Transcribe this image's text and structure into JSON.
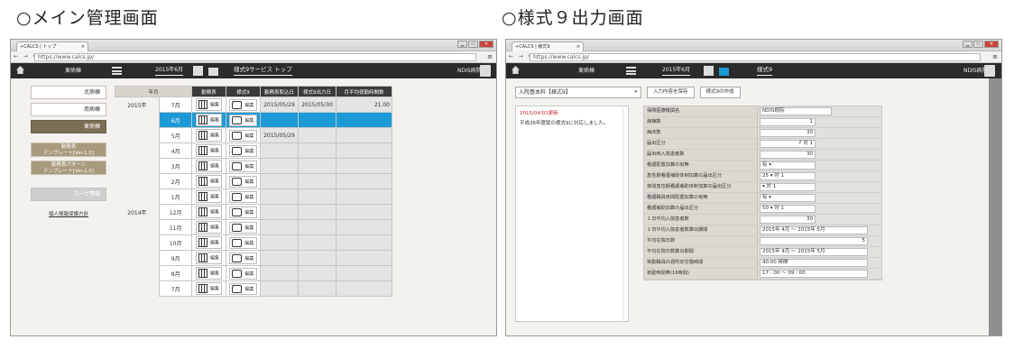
{
  "headings": {
    "left": "○メイン管理画面",
    "right": "○様式９出力画面"
  },
  "browser": {
    "tab_title": "+CALCS | トップ",
    "tab_title_right": "+CALCS | 様式9",
    "close": "×",
    "nav": "← → C",
    "url": "https://www.calcs.jp/",
    "menu": "≡"
  },
  "left": {
    "app": {
      "ward": "東病棟",
      "month": "2015年6月",
      "page": "様式9サービス トップ",
      "hospital": "NDIS病院"
    },
    "sidebar": [
      "北病棟",
      "南病棟",
      "東病棟"
    ],
    "tmpl1": [
      "勤務表",
      "テンプレート[Ver.1.0]"
    ],
    "tmpl2": [
      "勤務表パターン",
      "テンプレート[Ver.1.0]"
    ],
    "user": "ユーザ情報",
    "privacy": "個人情報保護方針",
    "cols": [
      "年月",
      "勤務表",
      "様式9",
      "勤務表取込日",
      "様式9出力日",
      "月平均夜勤時間数"
    ],
    "edit": "編集",
    "year2015": "2015年",
    "year2014": "2014年",
    "rows": [
      {
        "m": "7月",
        "c": "2015/05/29",
        "o": "2015/05/30",
        "n": "21.00"
      },
      {
        "m": "6月",
        "c": "",
        "o": "",
        "n": ""
      },
      {
        "m": "5月",
        "c": "2015/05/29",
        "o": "",
        "n": ""
      },
      {
        "m": "4月",
        "c": "",
        "o": "",
        "n": ""
      },
      {
        "m": "3月",
        "c": "",
        "o": "",
        "n": ""
      },
      {
        "m": "2月",
        "c": "",
        "o": "",
        "n": ""
      },
      {
        "m": "1月",
        "c": "",
        "o": "",
        "n": ""
      },
      {
        "m": "12月",
        "c": "",
        "o": "",
        "n": ""
      },
      {
        "m": "11月",
        "c": "",
        "o": "",
        "n": ""
      },
      {
        "m": "10月",
        "c": "",
        "o": "",
        "n": ""
      },
      {
        "m": "9月",
        "c": "",
        "o": "",
        "n": ""
      },
      {
        "m": "8月",
        "c": "",
        "o": "",
        "n": ""
      },
      {
        "m": "7月",
        "c": "",
        "o": "",
        "n": ""
      }
    ]
  },
  "right": {
    "app": {
      "ward": "東病棟",
      "month": "2015年6月",
      "page": "様式9",
      "hospital": "NDIS病院"
    },
    "select": "入院基本料【様式9】",
    "save": "入力内容を保存",
    "create": "様式9の作成",
    "note_date": "2015/04/01更新",
    "note_text": "平成26年度版の様式9に対応しました。",
    "form": [
      {
        "l": "保険医療機関名",
        "v": "NDIS病院"
      },
      {
        "l": "病棟数",
        "v": "1"
      },
      {
        "l": "病床数",
        "v": "30"
      },
      {
        "l": "届出区分",
        "v": "7 対 1"
      },
      {
        "l": "届出時入院患者数",
        "v": "30"
      },
      {
        "l": "看護配置加算の有無",
        "v": "有 ▾"
      },
      {
        "l": "急性期看護補助体制加算の届出区分",
        "v": "25 ▾ 対 1"
      },
      {
        "l": "夜間急性期看護補助体制加算の届出区分",
        "v": "▾ 対 1"
      },
      {
        "l": "看護職員夜間配置加算の有無",
        "v": "有 ▾"
      },
      {
        "l": "看護補助加算の届出区分",
        "v": "50 ▾ 対 1"
      },
      {
        "l": "１日平均入院患者数",
        "v": "30"
      },
      {
        "l": "１日平均入院患者数算出期間",
        "v": "2015年 4月 ～ 2015年 5月"
      },
      {
        "l": "平均在院日数",
        "v": "5"
      },
      {
        "l": "平均在院日数算出期間",
        "v": "2015年 4月 ～ 2015年 5月"
      },
      {
        "l": "常勤職員の週所定労働時間",
        "v": "40.00 時間"
      },
      {
        "l": "夜勤時間帯(16時間)",
        "v": "17 : 00 ～ 09 : 00"
      }
    ]
  }
}
